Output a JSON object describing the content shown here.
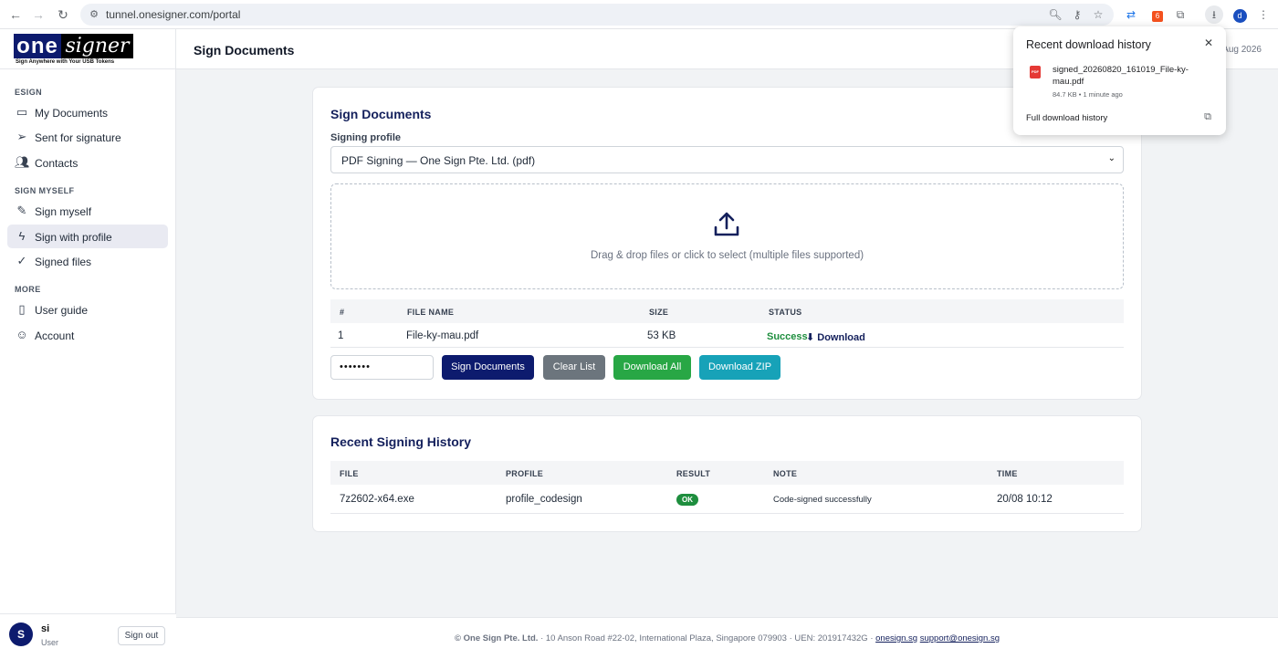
{
  "browser": {
    "url": "tunnel.onesigner.com/portal",
    "profile_initial": "d",
    "extension_badge": "6"
  },
  "logo": {
    "part1": "one",
    "part2": "signer",
    "tagline": "Sign Anywhere with Your USB Tokens"
  },
  "sidebar": {
    "sections": [
      {
        "label": "ESIGN",
        "items": [
          {
            "label": "My Documents",
            "icon": "document-icon"
          },
          {
            "label": "Sent for signature",
            "icon": "send-icon"
          },
          {
            "label": "Contacts",
            "icon": "contacts-icon"
          }
        ]
      },
      {
        "label": "SIGN MYSELF",
        "items": [
          {
            "label": "Sign myself",
            "icon": "pen-icon"
          },
          {
            "label": "Sign with profile",
            "icon": "bolt-icon",
            "active": true
          },
          {
            "label": "Signed files",
            "icon": "check-circle-icon"
          }
        ]
      },
      {
        "label": "MORE",
        "items": [
          {
            "label": "User guide",
            "icon": "book-icon"
          },
          {
            "label": "Account",
            "icon": "user-icon"
          }
        ]
      }
    ],
    "user": {
      "initial": "S",
      "name": "si",
      "role": "User",
      "signout_label": "Sign out"
    }
  },
  "topbar": {
    "title": "Sign Documents",
    "date_fragment": "Aug 2026"
  },
  "sign_card": {
    "title": "Sign Documents",
    "profile_label": "Signing profile",
    "profile_value": "PDF Signing — One Sign Pte. Ltd. (pdf)",
    "dropzone_text": "Drag & drop files or click to select (multiple files supported)",
    "columns": [
      "#",
      "FILE NAME",
      "SIZE",
      "STATUS"
    ],
    "rows": [
      {
        "index": "1",
        "file": "File-ky-mau.pdf",
        "size": "53 KB",
        "status": "Success",
        "download": "⬇ Download"
      }
    ],
    "password_mask": "•••••••",
    "buttons": {
      "sign": "Sign Documents",
      "clear": "Clear List",
      "download_all": "Download All",
      "download_zip": "Download ZIP"
    }
  },
  "history_card": {
    "title": "Recent Signing History",
    "columns": [
      "FILE",
      "PROFILE",
      "RESULT",
      "NOTE",
      "TIME"
    ],
    "rows": [
      {
        "file": "7z2602-x64.exe",
        "profile": "profile_codesign",
        "result": "OK",
        "note": "Code-signed successfully",
        "time": "20/08 10:12"
      }
    ]
  },
  "footer": {
    "copyright": "© One Sign Pte. Ltd.",
    "address": "· 10 Anson Road #22-02, International Plaza, Singapore 079903 · UEN: 201917432G ·",
    "link1": "onesign.sg",
    "link2": "support@onesign.sg"
  },
  "download_popup": {
    "title": "Recent download history",
    "file_name": "signed_20260820_161019_File-ky-mau.pdf",
    "file_meta": "84.7 KB • 1 minute ago",
    "full_history": "Full download history"
  },
  "colors": {
    "brand_navy": "#0d1b6e",
    "clear_gray": "#6c757d",
    "download_green": "#28a745",
    "zip_teal": "#17a2b8",
    "success_green": "#1e8e3e"
  }
}
